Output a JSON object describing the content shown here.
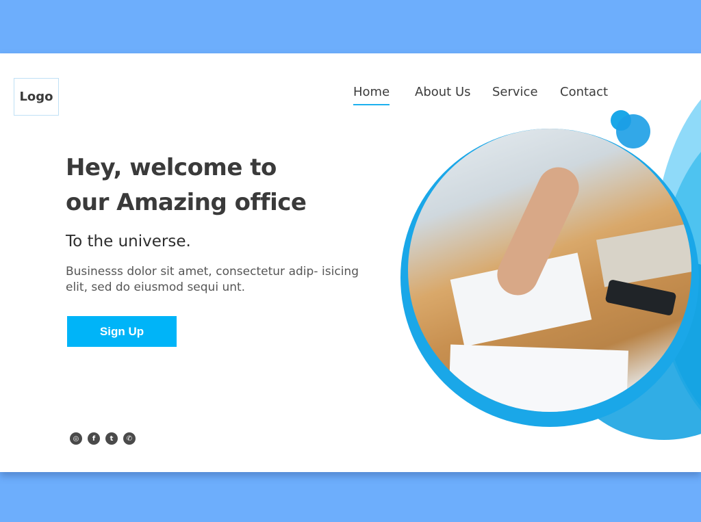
{
  "logo": "Logo",
  "nav": [
    {
      "label": "Home",
      "active": true
    },
    {
      "label": "About Us"
    },
    {
      "label": "Service"
    },
    {
      "label": "Contact"
    }
  ],
  "hero": {
    "title_line1": "Hey, welcome to",
    "title_line2": "our Amazing office",
    "subtitle": "To the universe.",
    "description": "Businesss dolor sit amet, consectetur adip- isicing elit, sed do eiusmod sequi unt.",
    "cta": "Sign Up"
  },
  "social": [
    {
      "icon": "instagram-icon",
      "glyph": "◎"
    },
    {
      "icon": "facebook-icon",
      "glyph": "f"
    },
    {
      "icon": "twitter-icon",
      "glyph": "t"
    },
    {
      "icon": "whatsapp-icon",
      "glyph": "✆"
    }
  ],
  "colors": {
    "accent": "#00b4f8",
    "background": "#6daefc",
    "text": "#3a3a3a"
  }
}
